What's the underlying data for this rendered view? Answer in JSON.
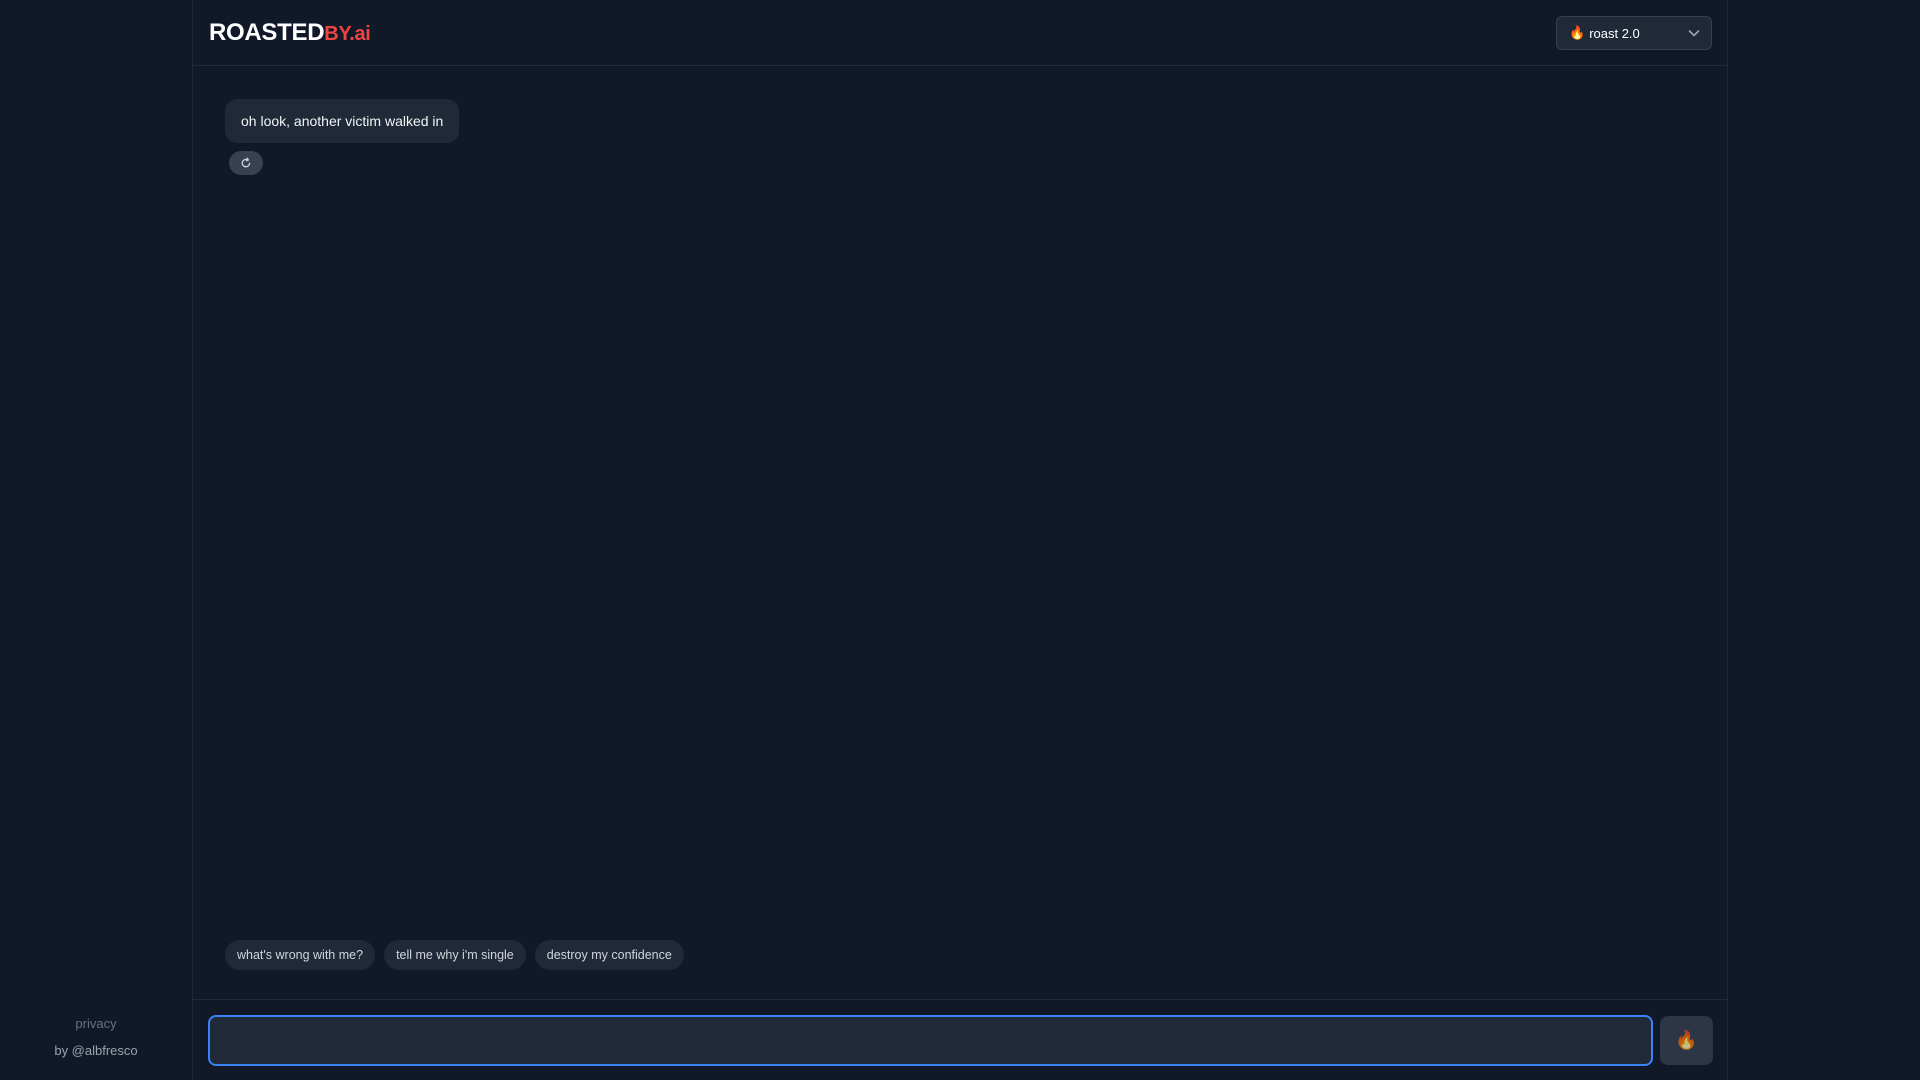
{
  "brand": {
    "name_main": "ROASTED",
    "name_sub": "BY.ai",
    "accent_color": "#ef4444"
  },
  "model_selector": {
    "icon": "fire-emoji",
    "icon_glyph": "🔥",
    "selected": "roast 2.0"
  },
  "messages": [
    {
      "role": "assistant",
      "text": "oh look, another victim walked in"
    }
  ],
  "regenerate": {
    "icon": "refresh-icon"
  },
  "suggestions": [
    "what's wrong with me?",
    "tell me why i'm single",
    "destroy my confidence"
  ],
  "composer": {
    "value": "",
    "placeholder": "",
    "focus_color": "#3b82f6",
    "send_icon": "fire-emoji",
    "send_glyph": "🔥"
  },
  "sidebar_footer": {
    "privacy_label": "privacy",
    "credit_label": "by @albfresco"
  }
}
